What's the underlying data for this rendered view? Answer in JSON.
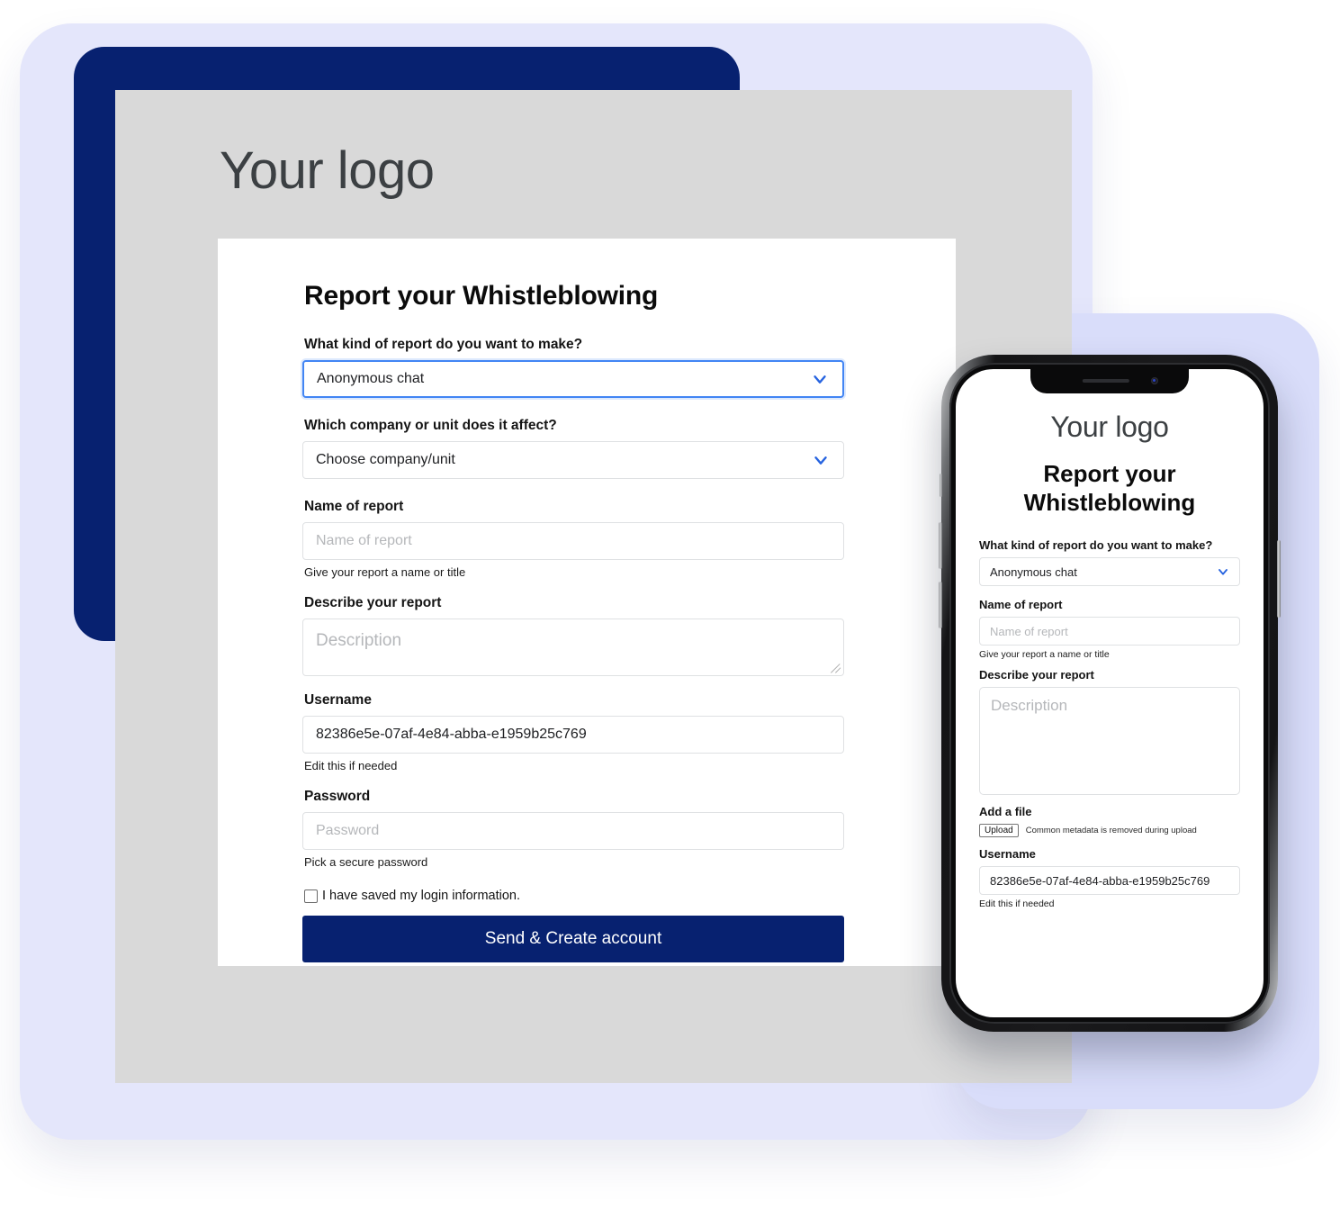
{
  "colors": {
    "navy": "#072170",
    "lavender_back": "#e4e6fb",
    "lavender_right": "#d9ddfa",
    "page_grey": "#d9d9d9",
    "card_white": "#ffffff",
    "focus_blue": "#4285f4",
    "chevron_blue": "#2764e0"
  },
  "desktop": {
    "logo": "Your logo",
    "form": {
      "title": "Report your Whistleblowing",
      "fields": {
        "report_kind": {
          "label": "What kind of report do you want to make?",
          "value": "Anonymous chat",
          "icon": "chevron-down-icon",
          "focused": true
        },
        "company_unit": {
          "label": "Which company or unit does it affect?",
          "value": "Choose company/unit",
          "icon": "chevron-down-icon"
        },
        "report_name": {
          "label": "Name of report",
          "placeholder": "Name of report",
          "value": "",
          "hint": "Give your report a name or title"
        },
        "description": {
          "label": "Describe your report",
          "placeholder": "Description",
          "value": ""
        },
        "username": {
          "label": "Username",
          "value": "82386e5e-07af-4e84-abba-e1959b25c769",
          "hint": "Edit this if needed"
        },
        "password": {
          "label": "Password",
          "placeholder": "Password",
          "value": "",
          "hint": "Pick a secure password"
        }
      },
      "checkbox": {
        "label": "I have saved my login information.",
        "checked": false
      },
      "submit_label": "Send & Create account"
    }
  },
  "phone": {
    "logo": "Your logo",
    "title": "Report your Whistleblowing",
    "hardware": {
      "notch": "notch",
      "speaker": "speaker-grille-icon",
      "camera": "front-camera-icon"
    },
    "form": {
      "report_kind": {
        "label": "What kind of report do you want to make?",
        "value": "Anonymous chat",
        "icon": "chevron-down-icon"
      },
      "report_name": {
        "label": "Name of report",
        "placeholder": "Name of report",
        "value": "",
        "hint": "Give your report a name or title"
      },
      "description": {
        "label": "Describe your report",
        "placeholder": "Description",
        "value": ""
      },
      "add_file": {
        "label": "Add a file",
        "button": "Upload",
        "note": "Common metadata is removed during upload"
      },
      "username": {
        "label": "Username",
        "value": "82386e5e-07af-4e84-abba-e1959b25c769",
        "hint": "Edit this if needed"
      }
    }
  }
}
